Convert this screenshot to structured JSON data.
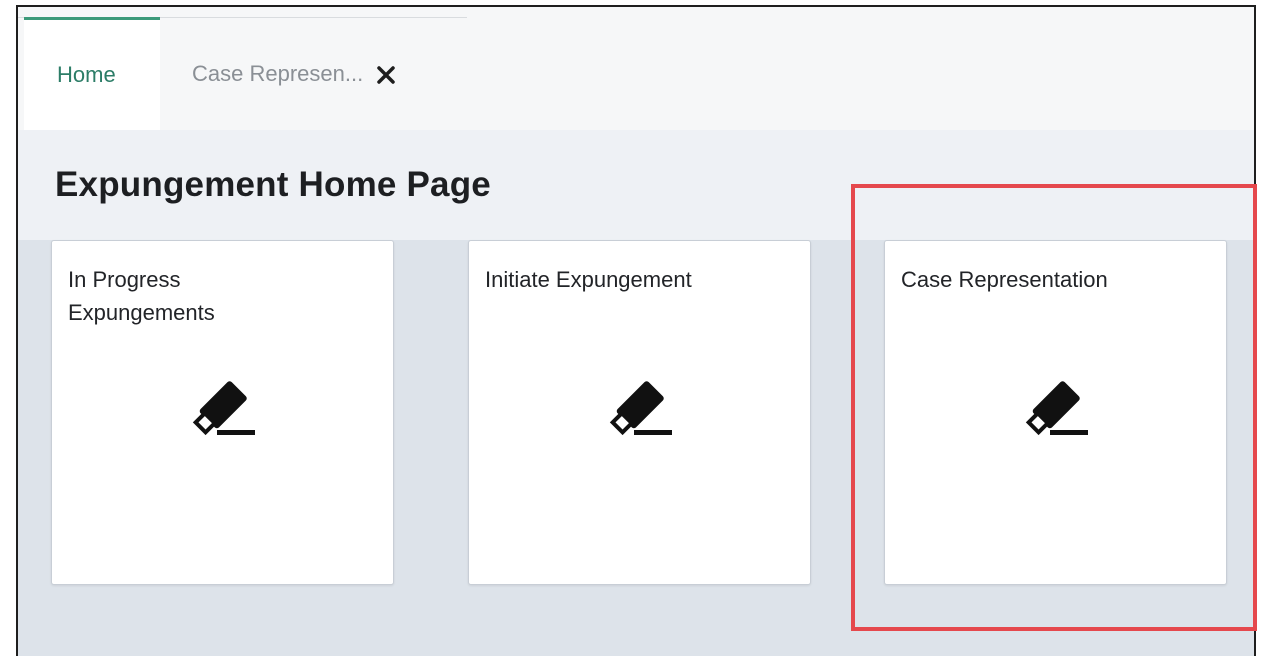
{
  "tabs": [
    {
      "label": "Home",
      "active": true
    },
    {
      "label": "Case Represen...",
      "active": false
    }
  ],
  "page": {
    "title": "Expungement Home Page"
  },
  "cards": [
    {
      "title": "In Progress\nExpungements",
      "icon": "eraser-icon"
    },
    {
      "title": "Initiate Expungement",
      "icon": "eraser-icon"
    },
    {
      "title": "Case Representation",
      "icon": "eraser-icon"
    }
  ],
  "colors": {
    "accent": "#3c9a7a",
    "highlight": "#e5484d"
  }
}
